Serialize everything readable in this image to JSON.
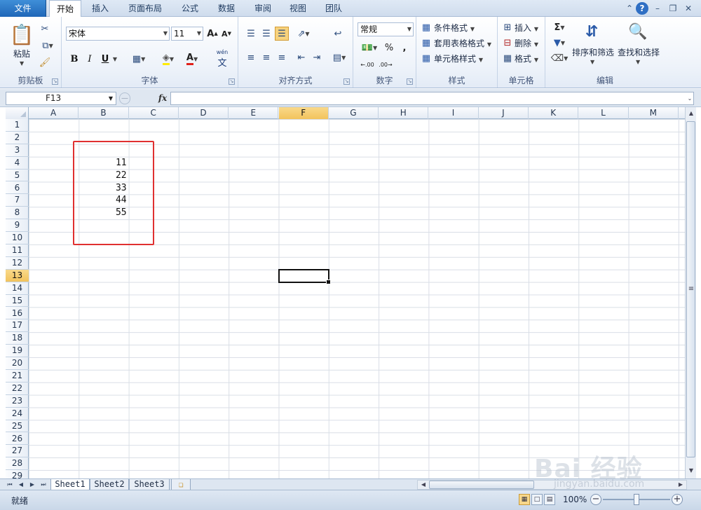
{
  "tabs": [
    {
      "label": "文件"
    },
    {
      "label": "开始"
    },
    {
      "label": "插入"
    },
    {
      "label": "页面布局"
    },
    {
      "label": "公式"
    },
    {
      "label": "数据"
    },
    {
      "label": "审阅"
    },
    {
      "label": "视图"
    },
    {
      "label": "团队"
    }
  ],
  "active_tab": "开始",
  "ribbon": {
    "clipboard": {
      "paste": "粘贴",
      "label": "剪贴板"
    },
    "font": {
      "name": "宋体",
      "size": "11",
      "bold": "B",
      "italic": "I",
      "underline": "U",
      "label": "字体",
      "grow": "A",
      "shrink": "A",
      "color_letter": "A",
      "pinyin": "wén"
    },
    "align": {
      "label": "对齐方式"
    },
    "number": {
      "format": "常规",
      "percent": "%",
      "comma": ",",
      "label": "数字"
    },
    "styles": {
      "cond": "条件格式",
      "table": "套用表格格式",
      "cell": "单元格样式",
      "label": "样式"
    },
    "cells": {
      "insert": "插入",
      "delete": "删除",
      "format": "格式",
      "label": "单元格"
    },
    "editing": {
      "sigma": "Σ",
      "sort": "排序和筛选",
      "find": "查找和选择",
      "label": "编辑"
    }
  },
  "formula_bar": {
    "name_box": "F13",
    "fx": "fx",
    "value": ""
  },
  "grid": {
    "columns": [
      "A",
      "B",
      "C",
      "D",
      "E",
      "F",
      "G",
      "H",
      "I",
      "J",
      "K",
      "L",
      "M"
    ],
    "rows": [
      "1",
      "2",
      "3",
      "4",
      "5",
      "6",
      "7",
      "8",
      "9",
      "10",
      "11",
      "12",
      "13",
      "14",
      "15",
      "16",
      "17",
      "18",
      "19",
      "20",
      "21",
      "22",
      "23",
      "24",
      "25",
      "26",
      "27",
      "28",
      "29"
    ],
    "selected_cell": "F13",
    "values": [
      {
        "cell": "B4",
        "value": "11"
      },
      {
        "cell": "B5",
        "value": "22"
      },
      {
        "cell": "B6",
        "value": "33"
      },
      {
        "cell": "B7",
        "value": "44"
      },
      {
        "cell": "B8",
        "value": "55"
      }
    ]
  },
  "sheets": [
    {
      "label": "Sheet1"
    },
    {
      "label": "Sheet2"
    },
    {
      "label": "Sheet3"
    }
  ],
  "active_sheet": "Sheet1",
  "status": {
    "ready": "就绪",
    "zoom": "100%"
  },
  "watermark": {
    "main": "Bai 经验",
    "sub": "jingyan.baidu.com"
  },
  "colors": {
    "selection_header": "#f2c35c",
    "annotation": "#e03030",
    "file_tab": "#1f66b8"
  }
}
